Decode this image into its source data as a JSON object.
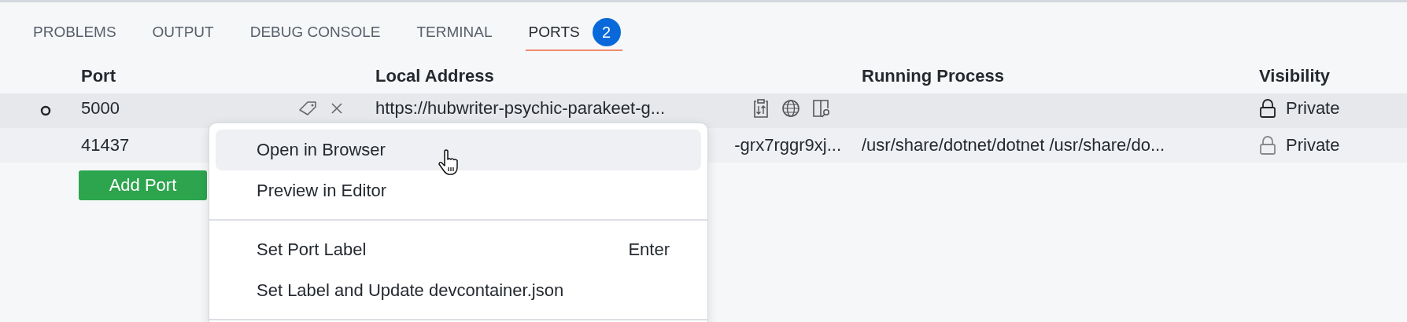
{
  "tabs": [
    {
      "label": "PROBLEMS",
      "selected": false
    },
    {
      "label": "OUTPUT",
      "selected": false
    },
    {
      "label": "DEBUG CONSOLE",
      "selected": false
    },
    {
      "label": "TERMINAL",
      "selected": false
    },
    {
      "label": "PORTS",
      "selected": true,
      "badge": "2"
    }
  ],
  "table": {
    "columns": [
      "Port",
      "Local Address",
      "Running Process",
      "Visibility"
    ],
    "rows": [
      {
        "selected": true,
        "port": "5000",
        "local_address": "https://hubwriter-psychic-parakeet-g...",
        "visibility": "Private"
      },
      {
        "selected": false,
        "port": "41437",
        "local_address": "-grx7rggr9xj...",
        "running_process": "/usr/share/dotnet/dotnet /usr/share/do...",
        "visibility": "Private"
      }
    ]
  },
  "add_port_button": "Add Port",
  "context_menu": {
    "items": [
      {
        "kind": "item",
        "label": "Open in Browser",
        "selected": true
      },
      {
        "kind": "item",
        "label": "Preview in Editor",
        "selected": false
      },
      {
        "kind": "separator"
      },
      {
        "kind": "item",
        "label": "Set Port Label",
        "shortcut": "Enter",
        "selected": false
      },
      {
        "kind": "item",
        "label": "Set Label and Update devcontainer.json",
        "selected": false
      },
      {
        "kind": "separator"
      }
    ]
  }
}
